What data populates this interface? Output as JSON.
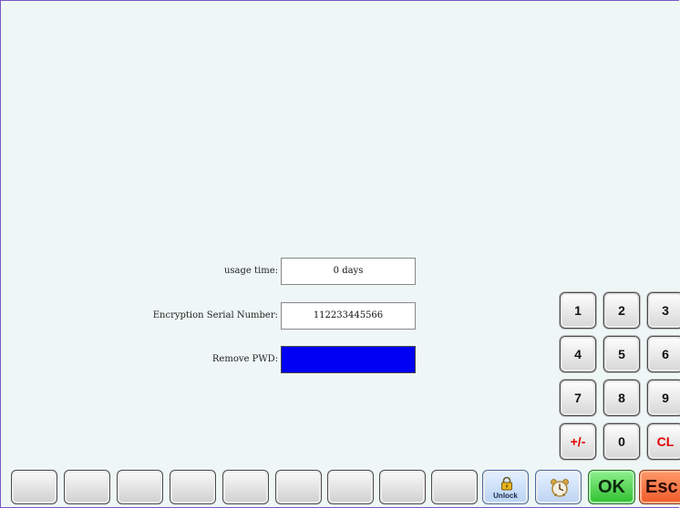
{
  "form": {
    "usage_time": {
      "label": "usage time:",
      "value": "0 days"
    },
    "serial": {
      "label": "Encryption Serial Number:",
      "value": "112233445566"
    },
    "remove_pwd": {
      "label": "Remove PWD:",
      "value": ""
    }
  },
  "keypad": {
    "k1": "1",
    "k2": "2",
    "k3": "3",
    "k4": "4",
    "k5": "5",
    "k6": "6",
    "k7": "7",
    "k8": "8",
    "k9": "9",
    "plusminus": "+/-",
    "k0": "0",
    "clear": "CL"
  },
  "bottom_bar": {
    "unlock_label": "Unlock",
    "ok_label": "OK",
    "esc_label": "Esc",
    "unlock_icon": "lock-icon",
    "alarm_icon": "alarm-clock-icon"
  },
  "colors": {
    "background": "#eef7f6",
    "remove_pwd_field": "#0000f5",
    "ok": "#2fbf2f",
    "esc": "#f05a2a",
    "keypad_red": "#e00000"
  }
}
